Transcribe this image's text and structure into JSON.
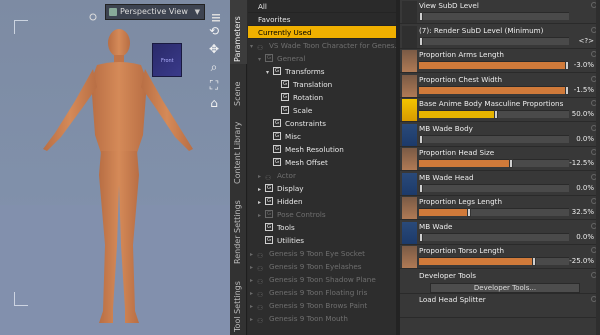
{
  "viewport": {
    "view_label": "Perspective View",
    "cube_label": "Front"
  },
  "vertical_tabs": [
    "Parameters",
    "Scene",
    "Content Library",
    "Render Settings",
    "Tool Settings"
  ],
  "tree": {
    "rows": [
      {
        "label": "All",
        "type": "top"
      },
      {
        "label": "Favorites",
        "type": "top"
      },
      {
        "label": "Currently Used",
        "type": "selected"
      },
      {
        "label": "VS Wade Toon Character for Genes...",
        "indent": 0,
        "arrow": "▾",
        "icon": "figure",
        "dim": true
      },
      {
        "label": "General",
        "indent": 1,
        "arrow": "▾",
        "icon": "G",
        "dim": true
      },
      {
        "label": "Transforms",
        "indent": 2,
        "arrow": "▾",
        "icon": "G",
        "dim": false
      },
      {
        "label": "Translation",
        "indent": 3,
        "arrow": "",
        "icon": "G",
        "dim": false
      },
      {
        "label": "Rotation",
        "indent": 3,
        "arrow": "",
        "icon": "G",
        "dim": false
      },
      {
        "label": "Scale",
        "indent": 3,
        "arrow": "",
        "icon": "G",
        "dim": false
      },
      {
        "label": "Constraints",
        "indent": 2,
        "arrow": "",
        "icon": "G",
        "dim": false
      },
      {
        "label": "Misc",
        "indent": 2,
        "arrow": "",
        "icon": "G",
        "dim": false
      },
      {
        "label": "Mesh Resolution",
        "indent": 2,
        "arrow": "",
        "icon": "G",
        "dim": false
      },
      {
        "label": "Mesh Offset",
        "indent": 2,
        "arrow": "",
        "icon": "G",
        "dim": false
      },
      {
        "label": "Actor",
        "indent": 1,
        "arrow": "▸",
        "icon": "figure",
        "dim": true
      },
      {
        "label": "Display",
        "indent": 1,
        "arrow": "▸",
        "icon": "G",
        "dim": false
      },
      {
        "label": "Hidden",
        "indent": 1,
        "arrow": "▸",
        "icon": "G",
        "dim": false
      },
      {
        "label": "Pose Controls",
        "indent": 1,
        "arrow": "▸",
        "icon": "G",
        "dim": true
      },
      {
        "label": "Tools",
        "indent": 1,
        "arrow": "",
        "icon": "G",
        "dim": false
      },
      {
        "label": "Utilities",
        "indent": 1,
        "arrow": "",
        "icon": "G",
        "dim": false
      },
      {
        "label": "Genesis 9 Toon Eye Socket",
        "indent": 0,
        "arrow": "▸",
        "icon": "figure",
        "dim": true
      },
      {
        "label": "Genesis 9 Toon Eyelashes",
        "indent": 0,
        "arrow": "▸",
        "icon": "figure",
        "dim": true
      },
      {
        "label": "Genesis 9 Toon Shadow Plane",
        "indent": 0,
        "arrow": "▸",
        "icon": "figure",
        "dim": true
      },
      {
        "label": "Genesis 9 Toon Floating Iris",
        "indent": 0,
        "arrow": "▸",
        "icon": "figure",
        "dim": true
      },
      {
        "label": "Genesis 9 Toon Brows Paint",
        "indent": 0,
        "arrow": "▸",
        "icon": "figure",
        "dim": true
      },
      {
        "label": "Genesis 9 Toon Mouth",
        "indent": 0,
        "arrow": "▸",
        "icon": "figure",
        "dim": true
      }
    ]
  },
  "params": {
    "rows": [
      {
        "label": "View SubD Level",
        "thumb": "dark",
        "kind": "slider",
        "value": "",
        "fill": "none",
        "knob": 0.0
      },
      {
        "label": "(7): Render SubD Level (Minimum)",
        "thumb": "dark",
        "kind": "slider",
        "value": "<?>",
        "fill": "none",
        "knob": 0.0
      },
      {
        "label": "Proportion Arms Length",
        "thumb": "skin",
        "kind": "slider",
        "value": "-3.0%",
        "fill": "orange",
        "knob": 0.97
      },
      {
        "label": "Proportion Chest Width",
        "thumb": "skin",
        "kind": "slider",
        "value": "-1.5%",
        "fill": "orange",
        "knob": 0.98
      },
      {
        "label": "Base Anime Body Masculine Proportions",
        "thumb": "yellow",
        "kind": "slider",
        "value": "50.0%",
        "fill": "yellow",
        "knob": 0.5
      },
      {
        "label": "MB Wade Body",
        "thumb": "blue",
        "kind": "slider",
        "value": "0.0%",
        "fill": "blue",
        "knob": 0.0
      },
      {
        "label": "Proportion Head Size",
        "thumb": "skin",
        "kind": "slider",
        "value": "-12.5%",
        "fill": "orange",
        "knob": 0.6
      },
      {
        "label": "MB Wade Head",
        "thumb": "blue",
        "kind": "slider",
        "value": "0.0%",
        "fill": "blue",
        "knob": 0.0
      },
      {
        "label": "Proportion Legs Length",
        "thumb": "skin",
        "kind": "slider",
        "value": "32.5%",
        "fill": "orange",
        "knob": 0.32
      },
      {
        "label": "MB Wade",
        "thumb": "blue",
        "kind": "slider",
        "value": "0.0%",
        "fill": "blue",
        "knob": 0.0
      },
      {
        "label": "Proportion Torso Length",
        "thumb": "skin",
        "kind": "slider",
        "value": "-25.0%",
        "fill": "orange",
        "knob": 0.75
      },
      {
        "label": "Developer Tools",
        "thumb": "none",
        "kind": "button",
        "button_label": "Developer Tools...",
        "value": ""
      },
      {
        "label": "Load Head Splitter",
        "thumb": "none",
        "kind": "label",
        "value": ""
      }
    ]
  }
}
